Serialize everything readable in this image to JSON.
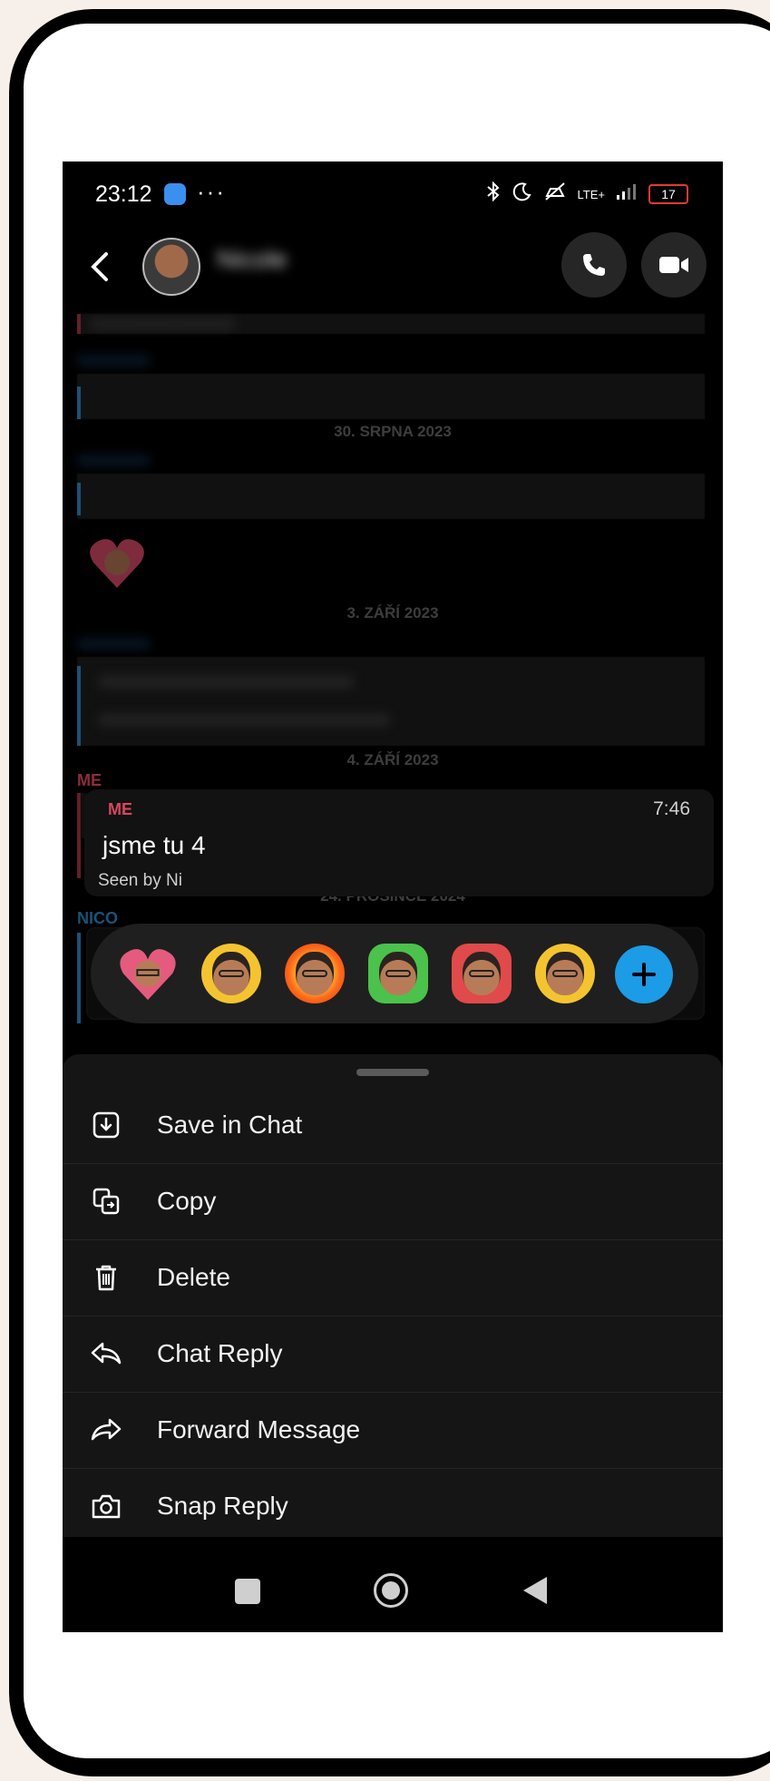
{
  "status_bar": {
    "time": "23:12",
    "dots": "···",
    "network": "LTE+",
    "battery": "17"
  },
  "header": {
    "back_icon": "chevron-left-icon",
    "contact_name": "Nicole",
    "contact_sub": "",
    "call_icon": "phone-icon",
    "video_icon": "video-camera-icon"
  },
  "chat": {
    "date_1": "30. SRPNA 2023",
    "date_2": "3. ZÁŘÍ 2023",
    "date_3": "4. ZÁŘÍ 2023",
    "date_4": "24. PROSINCE 2024",
    "sender_me_outer": "ME",
    "sender_nicole": "NICO",
    "selected_message": {
      "sender": "ME",
      "text": "jsme tu 4",
      "time": "7:46",
      "seen": "Seen by Ni"
    }
  },
  "reactions": [
    {
      "name": "heart-reaction"
    },
    {
      "name": "laughing-tears-reaction"
    },
    {
      "name": "fire-reaction"
    },
    {
      "name": "thumbs-up-reaction"
    },
    {
      "name": "thumbs-down-reaction"
    },
    {
      "name": "neutral-face-reaction"
    }
  ],
  "menu": {
    "items": [
      {
        "label": "Save in Chat",
        "icon": "save-download-icon"
      },
      {
        "label": "Copy",
        "icon": "copy-icon"
      },
      {
        "label": "Delete",
        "icon": "trash-icon"
      },
      {
        "label": "Chat Reply",
        "icon": "reply-icon"
      },
      {
        "label": "Forward Message",
        "icon": "forward-icon"
      },
      {
        "label": "Snap Reply",
        "icon": "camera-icon"
      }
    ]
  },
  "colors": {
    "me_accent": "#d7485b",
    "friend_accent": "#2a7fb8",
    "add_button": "#1c9be6",
    "battery_low": "#e53935"
  }
}
